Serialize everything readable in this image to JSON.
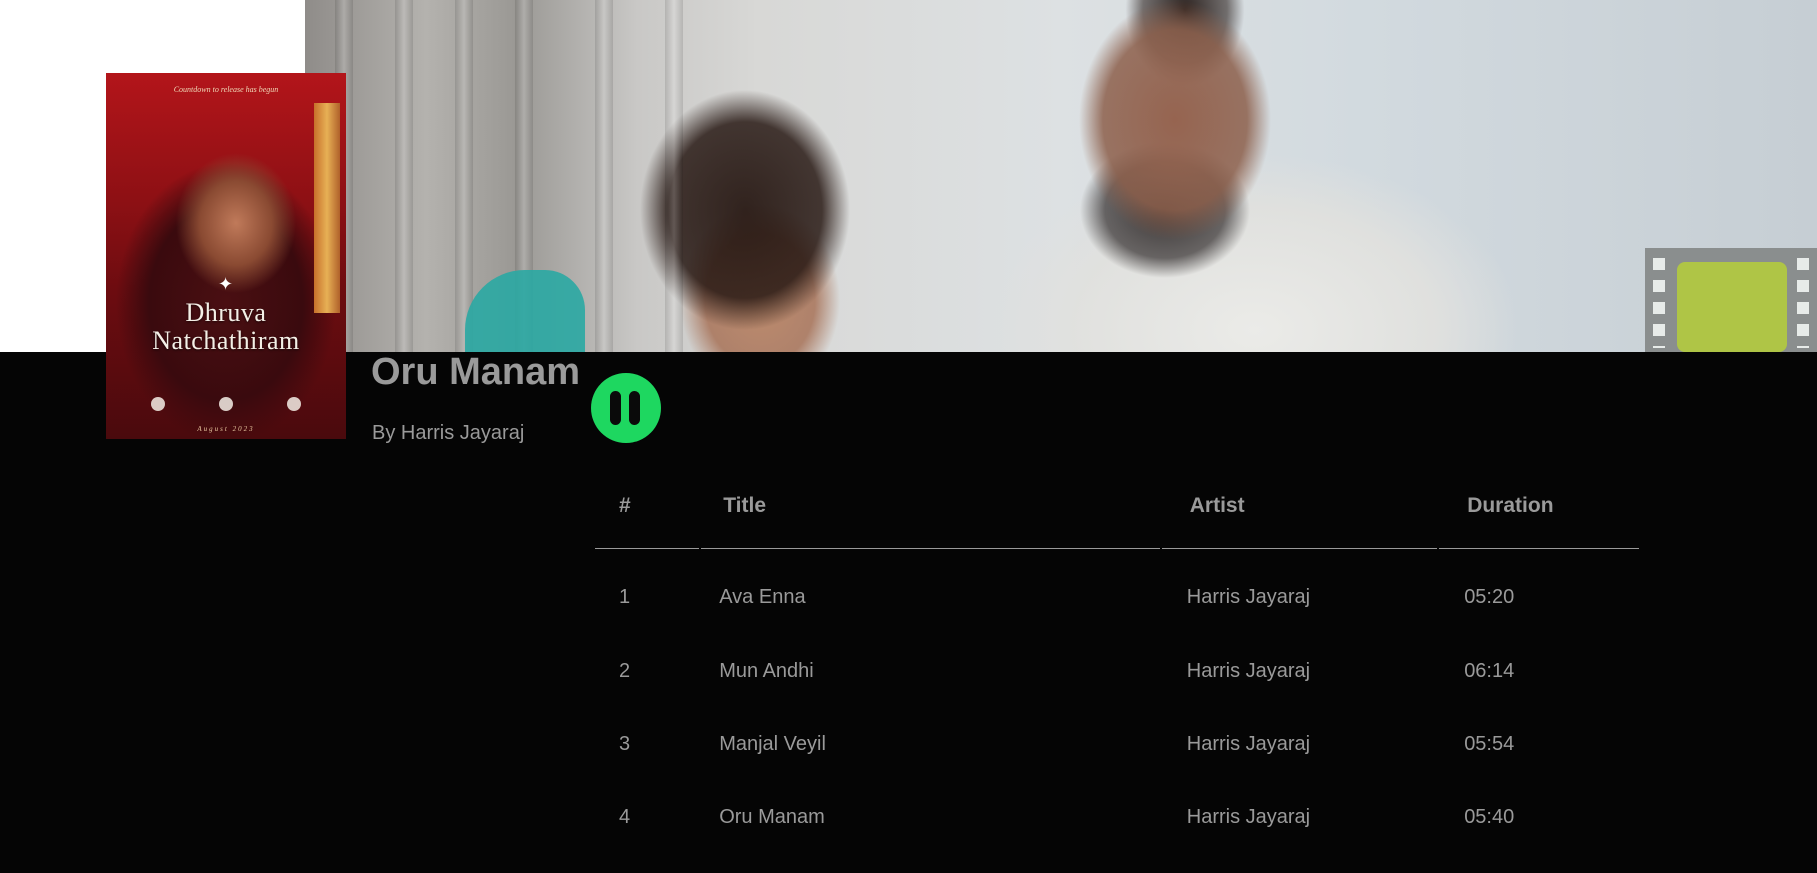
{
  "album": {
    "title": "Oru Manam",
    "artist": "By Harris Jayaraj",
    "cover": {
      "tagline": "Countdown to release has begun",
      "title_line1": "Dhruva",
      "title_line2": "Natchathiram",
      "footer": "August 2023"
    }
  },
  "player": {
    "state": "playing",
    "button_icon": "pause-icon",
    "accent_color": "#1ed760"
  },
  "table": {
    "headers": {
      "number": "#",
      "title": "Title",
      "artist": "Artist",
      "duration": "Duration"
    },
    "tracks": [
      {
        "number": "1",
        "title": "Ava Enna",
        "artist": "Harris Jayaraj",
        "duration": "05:20"
      },
      {
        "number": "2",
        "title": "Mun Andhi",
        "artist": "Harris Jayaraj",
        "duration": "06:14"
      },
      {
        "number": "3",
        "title": "Manjal Veyil",
        "artist": "Harris Jayaraj",
        "duration": "05:54"
      },
      {
        "number": "4",
        "title": "Oru Manam",
        "artist": "Harris Jayaraj",
        "duration": "05:40"
      }
    ]
  }
}
